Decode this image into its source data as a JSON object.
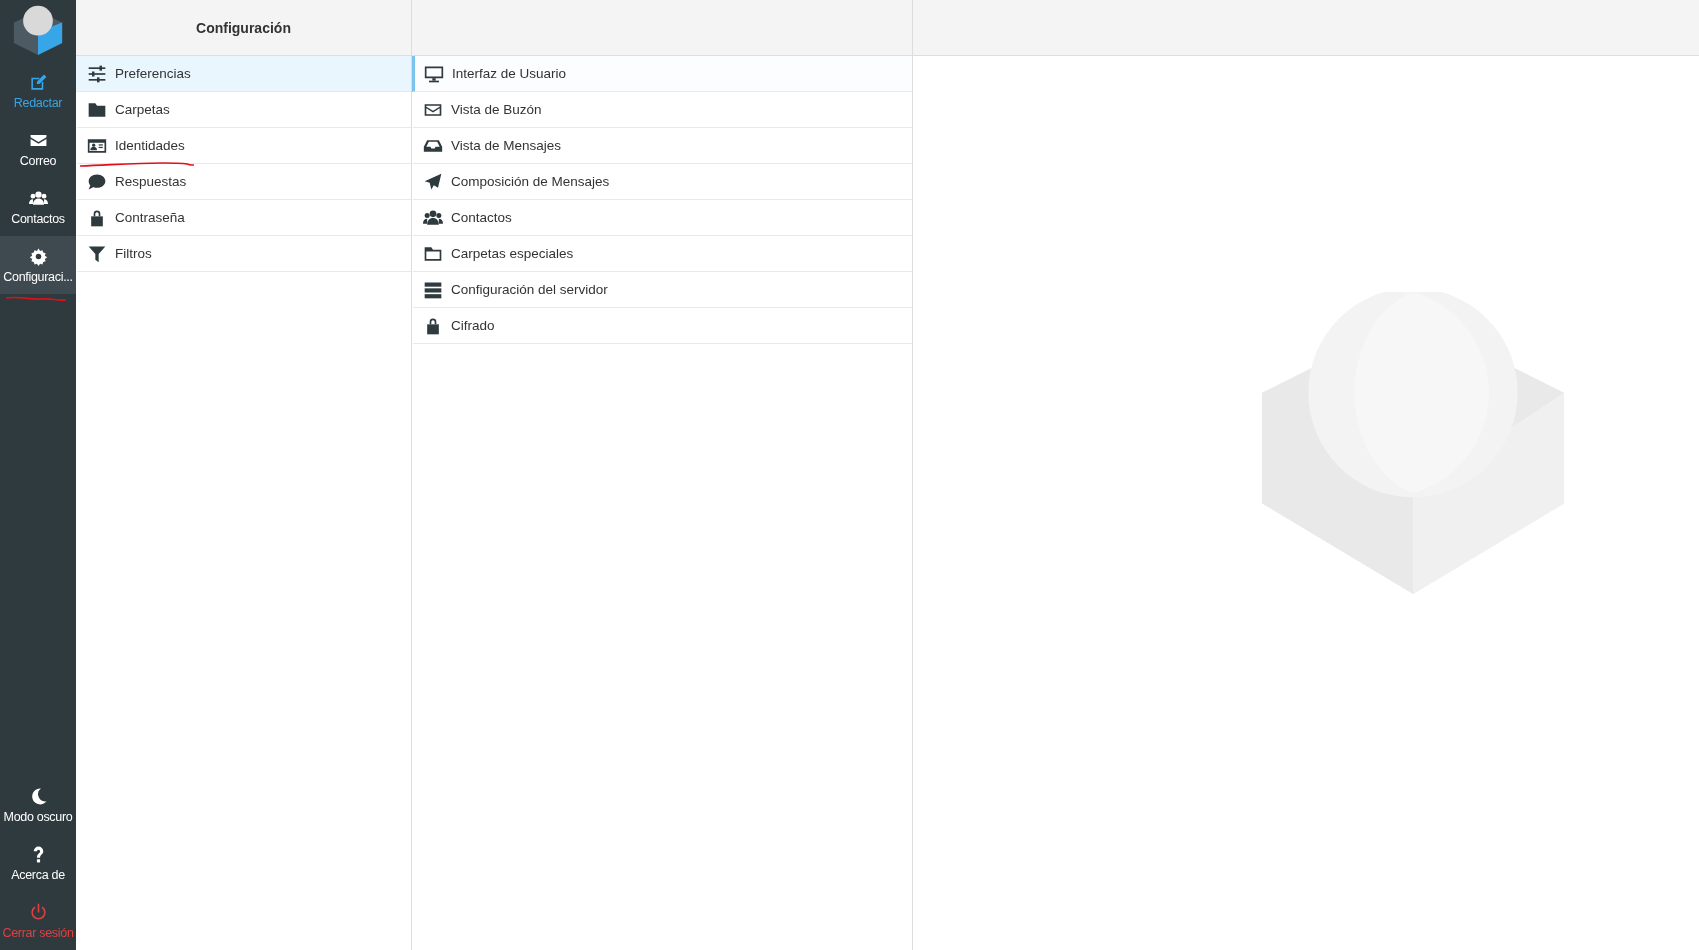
{
  "nav": {
    "items": [
      {
        "label": "Redactar",
        "kind": "compose",
        "selected": false,
        "underlined": false
      },
      {
        "label": "Correo",
        "kind": "mail",
        "selected": false,
        "underlined": false
      },
      {
        "label": "Contactos",
        "kind": "people",
        "selected": false,
        "underlined": false
      },
      {
        "label": "Configuraci...",
        "kind": "gear",
        "selected": true,
        "underlined": true
      }
    ],
    "bottom": [
      {
        "label": "Modo oscuro",
        "kind": "moon"
      },
      {
        "label": "Acerca de",
        "kind": "question"
      },
      {
        "label": "Cerrar sesión",
        "kind": "power"
      }
    ]
  },
  "settings": {
    "title": "Configuración",
    "items": [
      {
        "label": "Preferencias",
        "kind": "sliders",
        "selected": true,
        "underlined": false
      },
      {
        "label": "Carpetas",
        "kind": "folder",
        "selected": false,
        "underlined": false
      },
      {
        "label": "Identidades",
        "kind": "idcard",
        "selected": false,
        "underlined": true
      },
      {
        "label": "Respuestas",
        "kind": "bubble",
        "selected": false,
        "underlined": false
      },
      {
        "label": "Contraseña",
        "kind": "lock",
        "selected": false,
        "underlined": false
      },
      {
        "label": "Filtros",
        "kind": "filter",
        "selected": false,
        "underlined": false
      }
    ]
  },
  "sections": {
    "items": [
      {
        "label": "Interfaz de Usuario",
        "kind": "monitor",
        "selected": true
      },
      {
        "label": "Vista de Buzón",
        "kind": "envelope",
        "selected": false
      },
      {
        "label": "Vista de Mensajes",
        "kind": "inbox",
        "selected": false
      },
      {
        "label": "Composición de Mensajes",
        "kind": "plane",
        "selected": false
      },
      {
        "label": "Contactos",
        "kind": "people",
        "selected": false
      },
      {
        "label": "Carpetas especiales",
        "kind": "folderline",
        "selected": false
      },
      {
        "label": "Configuración del servidor",
        "kind": "server",
        "selected": false
      },
      {
        "label": "Cifrado",
        "kind": "lock",
        "selected": false
      }
    ]
  }
}
